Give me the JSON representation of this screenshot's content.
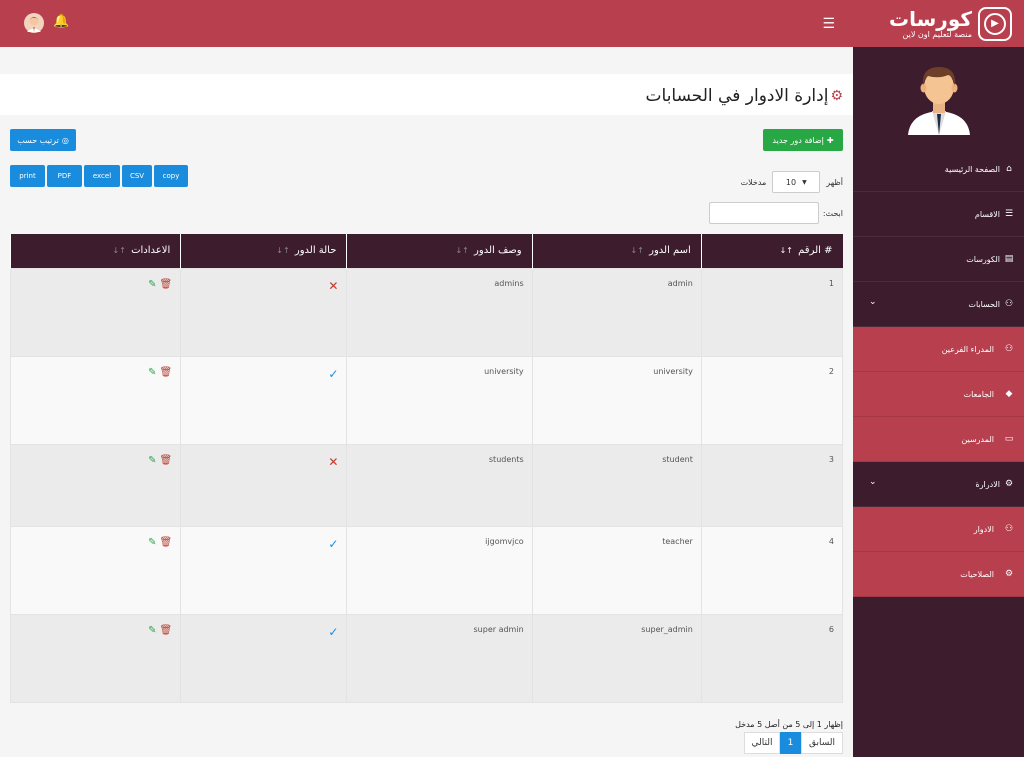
{
  "brand": {
    "title": "كورسات",
    "subtitle": "منصة لتعليم اون لاين"
  },
  "sidebar": {
    "items": [
      {
        "label": "الصفحة الرئيسية",
        "icon": "home-icon",
        "type": "main"
      },
      {
        "label": "الاقسام",
        "icon": "list-icon",
        "type": "main"
      },
      {
        "label": "الكورسات",
        "icon": "book-icon",
        "type": "main"
      },
      {
        "label": "الحسابات",
        "icon": "users-icon",
        "type": "main",
        "expandable": true
      },
      {
        "label": "المدراء الفرعين",
        "icon": "users-icon",
        "type": "sub"
      },
      {
        "label": "الجامعات",
        "icon": "graduation-icon",
        "type": "sub"
      },
      {
        "label": "المدرسين",
        "icon": "teacher-icon",
        "type": "sub"
      },
      {
        "label": "الادرارة",
        "icon": "cogs-icon",
        "type": "main",
        "expandable": true
      },
      {
        "label": "الادوار",
        "icon": "users-icon",
        "type": "sub"
      },
      {
        "label": "الصلاحيات",
        "icon": "cogs-icon",
        "type": "sub"
      }
    ]
  },
  "page": {
    "title": "إدارة الادوار في الحسابات"
  },
  "toolbar": {
    "add_label": "إضافة دور جديد",
    "sort_label": "ترتيب حسب"
  },
  "export": {
    "buttons": [
      "print",
      "PDF",
      "excel",
      "CSV",
      "copy"
    ]
  },
  "length": {
    "show_label": "أظهر",
    "value": "10",
    "entries_label": "مدخلات"
  },
  "search": {
    "label": "ابحث:",
    "placeholder": ""
  },
  "table": {
    "headers": [
      "# الرقم",
      "اسم الدور",
      "وصف الدور",
      "حالة الدور",
      "الاعدادات"
    ],
    "rows": [
      {
        "num": "1",
        "name": "admin",
        "desc": "admins",
        "status": "inactive"
      },
      {
        "num": "2",
        "name": "university",
        "desc": "university",
        "status": "active"
      },
      {
        "num": "3",
        "name": "student",
        "desc": "students",
        "status": "inactive"
      },
      {
        "num": "4",
        "name": "teacher",
        "desc": "ijgomvjco",
        "status": "active"
      },
      {
        "num": "6",
        "name": "super_admin",
        "desc": "super admin",
        "status": "active"
      }
    ]
  },
  "footer": {
    "info": "إظهار 1 إلى 5 من أصل 5 مدخل",
    "prev": "السابق",
    "page": "1",
    "next": "التالي"
  },
  "colors": {
    "primary": "#b8404e",
    "dark": "#3d1c2e",
    "blue": "#1a8cdd",
    "green": "#28a745"
  }
}
